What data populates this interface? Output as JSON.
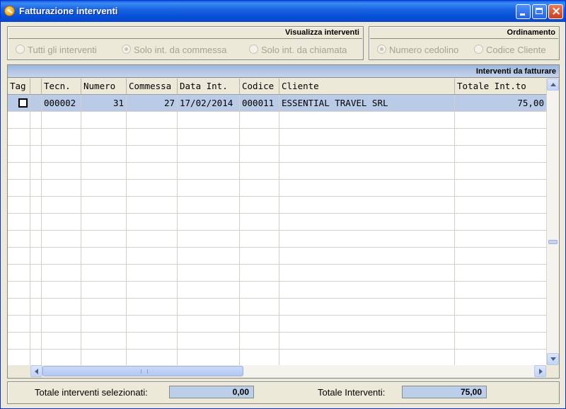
{
  "window": {
    "title": "Fatturazione interventi"
  },
  "visualizza": {
    "header": "Visualizza interventi",
    "options": [
      {
        "label": "Tutti gli interventi",
        "selected": false
      },
      {
        "label": "Solo int. da commessa",
        "selected": true
      },
      {
        "label": "Solo int. da chiamata",
        "selected": false
      }
    ]
  },
  "ordinamento": {
    "header": "Ordinamento",
    "options": [
      {
        "label": "Numero cedolino",
        "selected": true
      },
      {
        "label": "Codice Cliente",
        "selected": false
      }
    ]
  },
  "grid": {
    "header": "Interventi da fatturare",
    "columns": [
      "Tag",
      "",
      "Tecn.",
      "Numero",
      "Commessa",
      "Data Int.",
      "Codice",
      "Cliente",
      "Totale Int.to"
    ],
    "rows": [
      {
        "tag": false,
        "tecn": "000002",
        "numero": "31",
        "commessa": "27",
        "data": "17/02/2014",
        "codice": "000011",
        "cliente": "ESSENTIAL TRAVEL SRL",
        "totale": "75,00"
      }
    ]
  },
  "footer": {
    "selected_label": "Totale interventi selezionati:",
    "selected_value": "0,00",
    "total_label": "Totale Interventi:",
    "total_value": "75,00"
  },
  "colors": {
    "title_bar": "#0a5fe0",
    "selected_row": "#b9cbe7",
    "header_band": "#9db6dc"
  }
}
